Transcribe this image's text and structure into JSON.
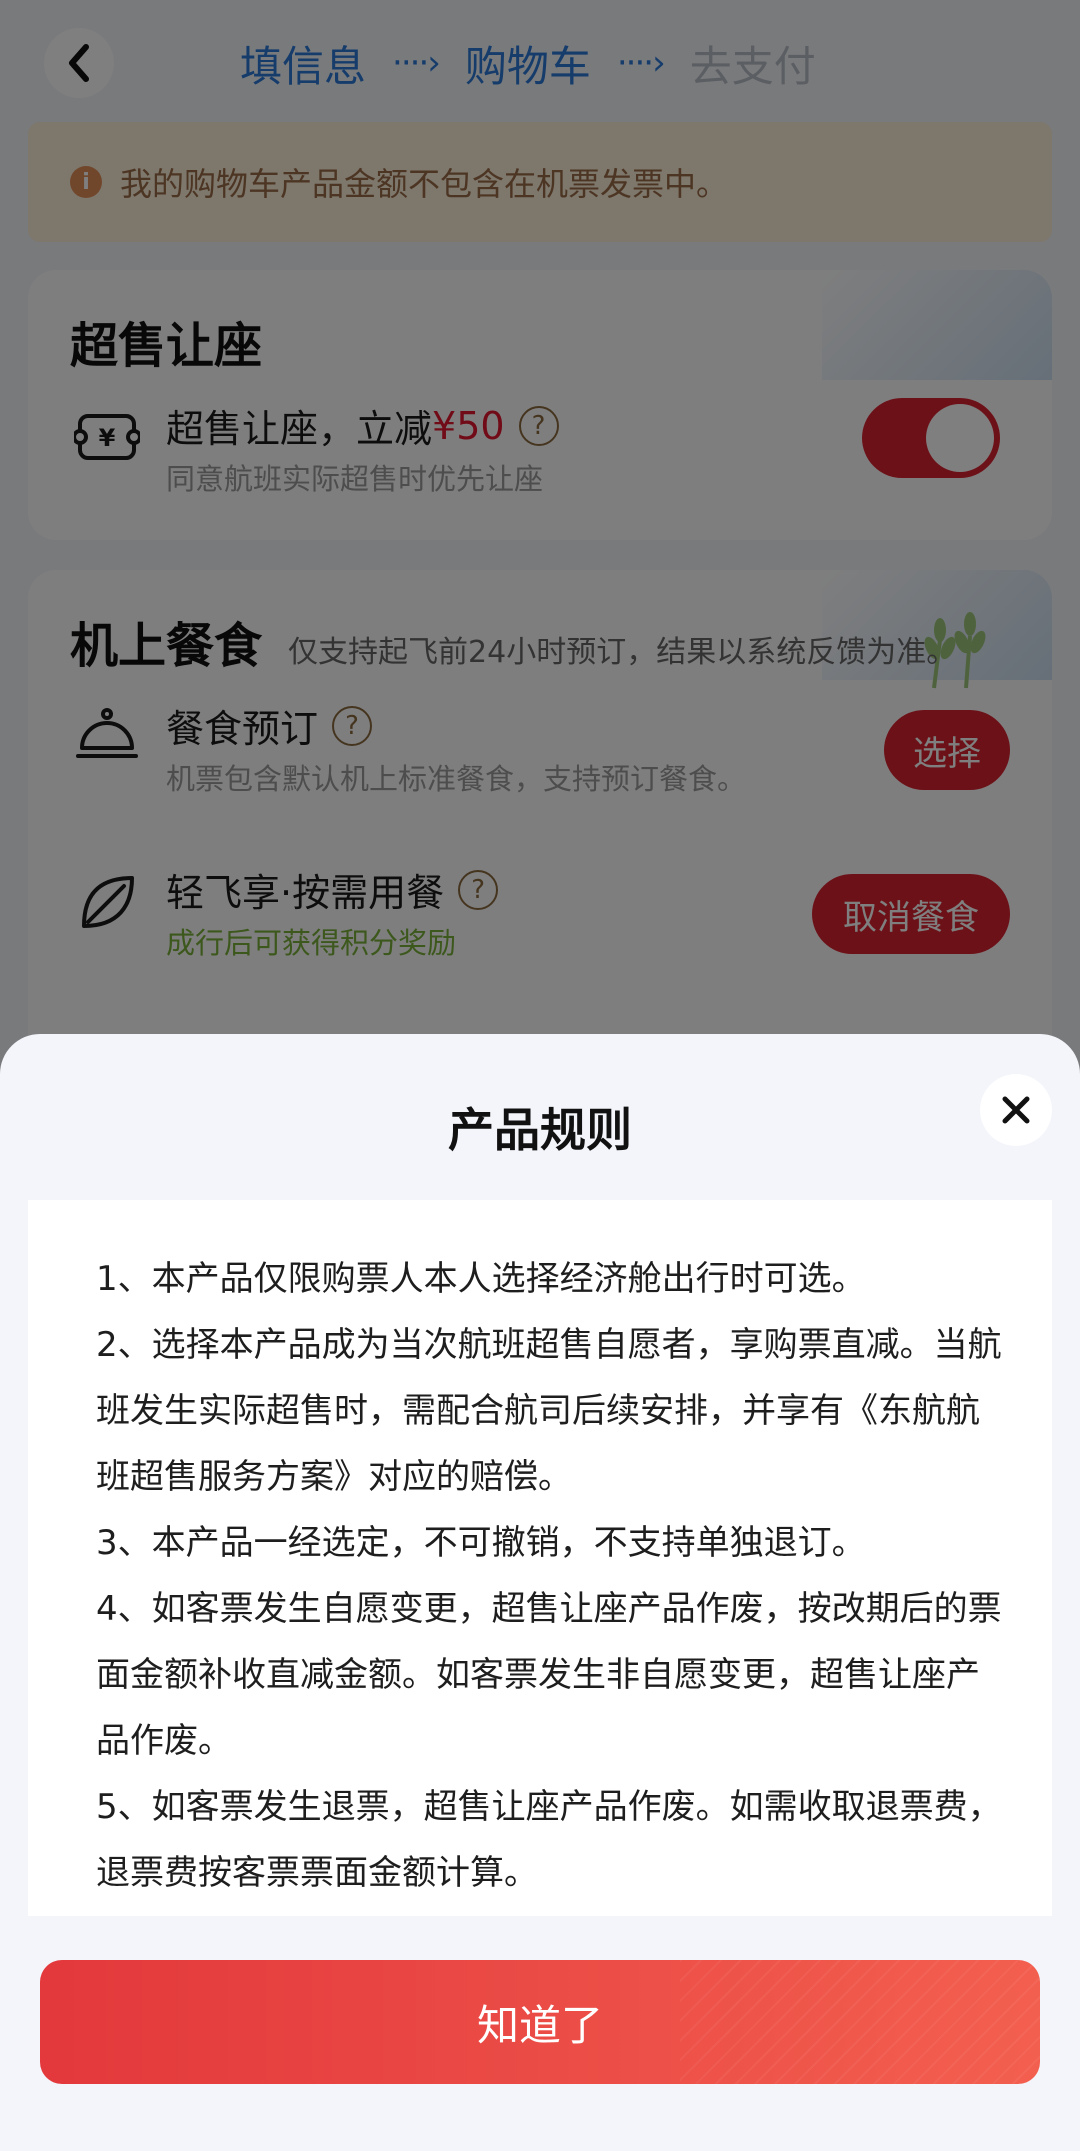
{
  "nav": {
    "steps": [
      {
        "label": "填信息"
      },
      {
        "label": "购物车"
      },
      {
        "label": "去支付"
      }
    ],
    "arrow": "····›"
  },
  "notice": {
    "icon": "i",
    "text": "我的购物车产品金额不包含在机票发票中。"
  },
  "oversale": {
    "title": "超售让座",
    "item": {
      "title_prefix": "超售让座，立减",
      "price": "¥50",
      "help": "?",
      "desc": "同意航班实际超售时优先让座",
      "toggle_on": true
    }
  },
  "meal": {
    "title": "机上餐食",
    "subtitle": "仅支持起飞前24小时预订，结果以系统反馈为准。",
    "items": [
      {
        "title": "餐食预订",
        "help": "?",
        "desc": "机票包含默认机上标准餐食，支持预订餐食。",
        "button": "选择"
      },
      {
        "title": "轻飞享·按需用餐",
        "help": "?",
        "desc": "成行后可获得积分奖励",
        "button": "取消餐食"
      }
    ]
  },
  "sheet": {
    "title": "产品规则",
    "rules": [
      "1、本产品仅限购票人本人选择经济舱出行时可选。",
      "2、选择本产品成为当次航班超售自愿者，享购票直减。当航班发生实际超售时，需配合航司后续安排，并享有《东航航班超售服务方案》对应的赔偿。",
      "3、本产品一经选定，不可撤销，不支持单独退订。",
      "4、如客票发生自愿变更，超售让座产品作废，按改期后的票面金额补收直减金额。如客票发生非自愿变更，超售让座产品作废。",
      "5、如客票发生退票，超售让座产品作废。如需收取退票费，退票费按客票票面金额计算。"
    ],
    "confirm": "知道了"
  },
  "colors": {
    "brand_red": "#d9232f",
    "step_active": "#2a79d6",
    "step_inactive": "#b7bcc4",
    "notice_bg": "#fbeed9",
    "notice_text": "#9b6b47",
    "eco_green": "#7bb03a"
  }
}
